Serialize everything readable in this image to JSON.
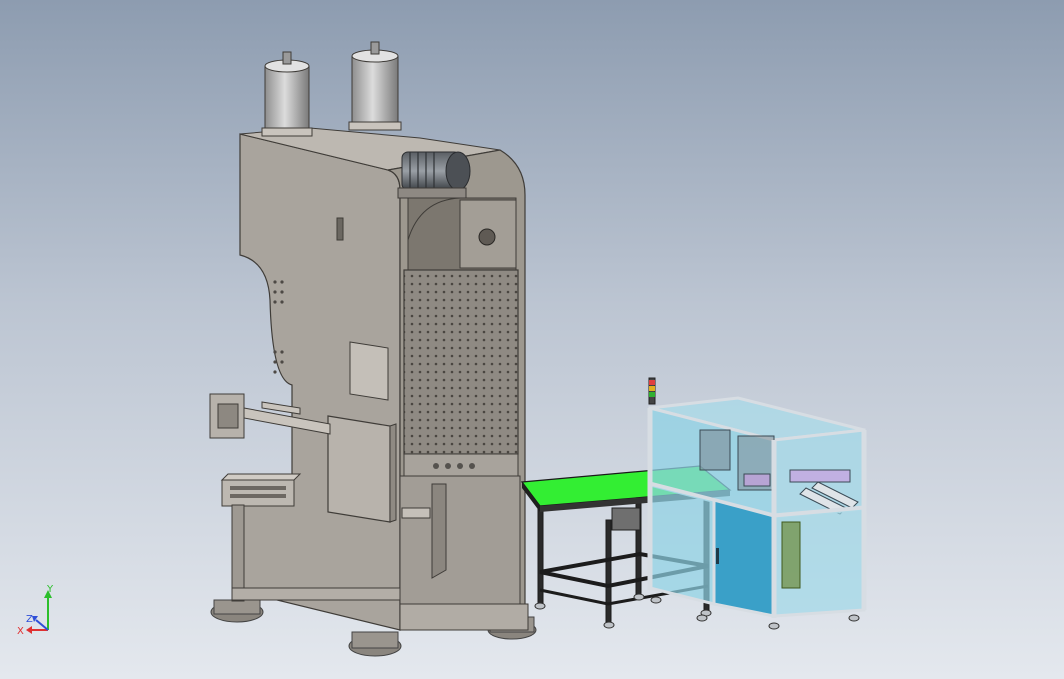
{
  "colors": {
    "background_top": "#8d9cb0",
    "background_bottom": "#e4e8ee",
    "press_body": "#a7a29b",
    "press_shadow": "#7f7a73",
    "conveyor_belt": "#33ee33",
    "enclosure_glass": "#8fd3e6",
    "enclosure_door": "#3aa0c8",
    "frame_steel": "#c9cfd6",
    "axis_x": "#e03030",
    "axis_y": "#2cbf2c",
    "axis_z": "#2f4fd8"
  },
  "triad": {
    "x_label": "X",
    "y_label": "Y",
    "z_label": "Z"
  }
}
